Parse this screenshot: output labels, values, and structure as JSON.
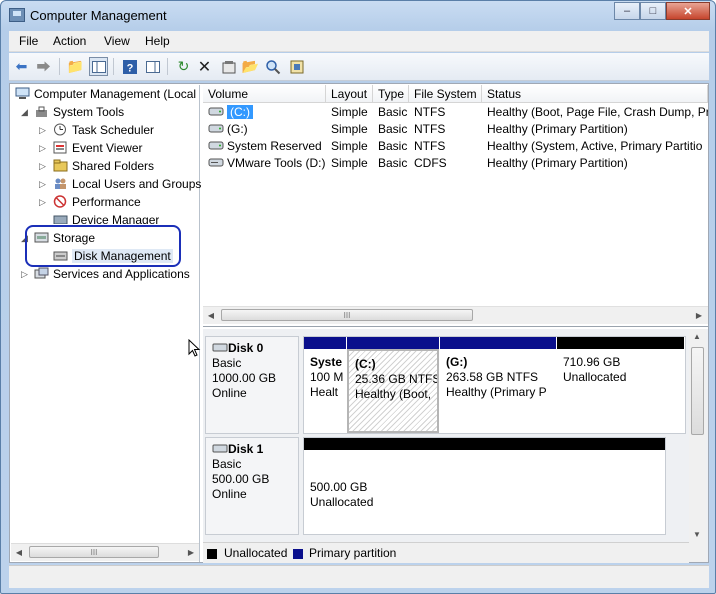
{
  "window": {
    "title": "Computer Management"
  },
  "caption_buttons": {
    "minimize": "–",
    "maximize": "□",
    "close": "✕"
  },
  "menu": [
    "File",
    "Action",
    "View",
    "Help"
  ],
  "toolbar": {
    "icons": [
      "back-arrow-icon",
      "forward-arrow-icon",
      "up-folder-icon",
      "show-hide-tree-icon",
      "help-icon",
      "show-hide-action-pane-icon",
      "refresh-icon",
      "delete-icon",
      "properties-icon",
      "open-icon",
      "search-icon",
      "export-icon"
    ]
  },
  "tree": {
    "root": "Computer Management (Local",
    "system_tools": "System Tools",
    "items": [
      "Task Scheduler",
      "Event Viewer",
      "Shared Folders",
      "Local Users and Groups",
      "Performance",
      "Device Manager"
    ],
    "storage": "Storage",
    "disk_management": "Disk Management",
    "services": "Services and Applications"
  },
  "volume_list": {
    "columns": [
      "Volume",
      "Layout",
      "Type",
      "File System",
      "Status"
    ],
    "rows": [
      {
        "volume": "(C:)",
        "layout": "Simple",
        "type": "Basic",
        "fs": "NTFS",
        "status": "Healthy (Boot, Page File, Crash Dump, Pri"
      },
      {
        "volume": "(G:)",
        "layout": "Simple",
        "type": "Basic",
        "fs": "NTFS",
        "status": "Healthy (Primary Partition)"
      },
      {
        "volume": "System Reserved",
        "layout": "Simple",
        "type": "Basic",
        "fs": "NTFS",
        "status": "Healthy (System, Active, Primary Partitio"
      },
      {
        "volume": "VMware Tools (D:)",
        "layout": "Simple",
        "type": "Basic",
        "fs": "CDFS",
        "status": "Healthy (Primary Partition)"
      }
    ],
    "scroll_grip": "III"
  },
  "disks": [
    {
      "name": "Disk 0",
      "kind": "Basic",
      "size": "1000.00 GB",
      "state": "Online",
      "partitions": [
        {
          "line1": "Syste",
          "line2": "100 M",
          "line3": "Healt"
        },
        {
          "line1": "(C:)",
          "line2": "25.36 GB NTFS",
          "line3": "Healthy (Boot,"
        },
        {
          "line1": "(G:)",
          "line2": "263.58 GB NTFS",
          "line3": "Healthy (Primary P"
        },
        {
          "line1": "",
          "line2": "710.96 GB",
          "line3": "Unallocated"
        }
      ]
    },
    {
      "name": "Disk 1",
      "kind": "Basic",
      "size": "500.00 GB",
      "state": "Online",
      "partitions": [
        {
          "line1": "500.00 GB",
          "line2": "Unallocated"
        }
      ]
    }
  ],
  "legend": [
    {
      "label": "Unallocated",
      "color": "#000000"
    },
    {
      "label": "Primary partition",
      "color": "#0a0f8c"
    }
  ],
  "colors": {
    "primary": "#0a0f8c",
    "unallocated": "#000000",
    "highlight": "#1b2fb8"
  }
}
